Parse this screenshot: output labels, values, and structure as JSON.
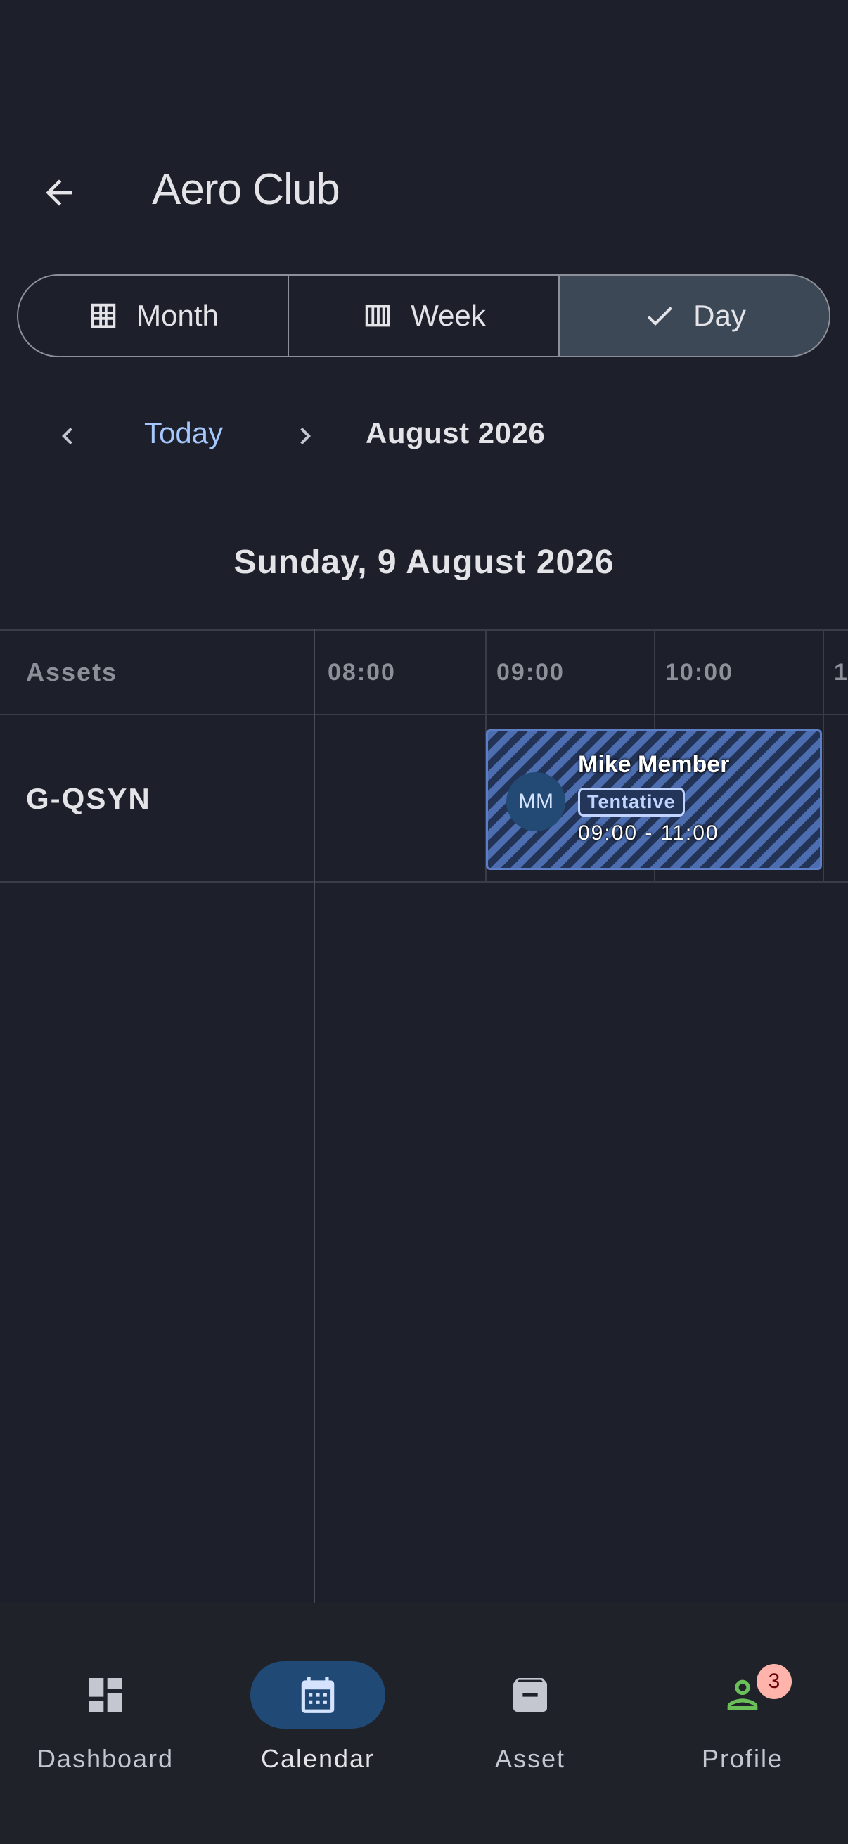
{
  "app": {
    "title": "Aero Club"
  },
  "view_selector": {
    "options": [
      {
        "label": "Month",
        "icon": "grid-icon",
        "selected": false
      },
      {
        "label": "Week",
        "icon": "columns-icon",
        "selected": false
      },
      {
        "label": "Day",
        "icon": "check-icon",
        "selected": true
      }
    ]
  },
  "date_nav": {
    "today_label": "Today",
    "month_label": "August 2026"
  },
  "day_heading": "Sunday, 9 August 2026",
  "timeline": {
    "assets_header": "Assets",
    "times": [
      "08:00",
      "09:00",
      "10:00",
      "1"
    ],
    "assets": [
      {
        "name": "G-QSYN"
      }
    ],
    "bookings": [
      {
        "asset": "G-QSYN",
        "initials": "MM",
        "name": "Mike Member",
        "status": "Tentative",
        "time": "09:00 - 11:00"
      }
    ]
  },
  "bottom_nav": {
    "items": [
      {
        "label": "Dashboard",
        "icon": "dashboard-icon",
        "active": false
      },
      {
        "label": "Calendar",
        "icon": "calendar-icon",
        "active": true
      },
      {
        "label": "Asset",
        "icon": "archive-icon",
        "active": false
      },
      {
        "label": "Profile",
        "icon": "person-icon",
        "active": false,
        "badge": "3"
      }
    ]
  },
  "colors": {
    "background": "#1d202a",
    "accent": "#a6c8ff",
    "selected_segment": "#3d4857",
    "booking_stripe": "#4c6eb0",
    "profile_icon": "#6bbf59",
    "badge": "#ffb4ab"
  }
}
